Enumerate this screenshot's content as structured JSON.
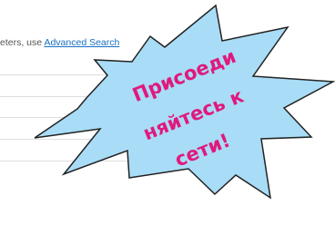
{
  "search": {
    "hint_prefix": "eters, use ",
    "advanced_link": "Advanced Search",
    "rows": 4
  },
  "promo": {
    "lines": [
      "Присоеди",
      "няйтесь к",
      "сети!"
    ],
    "fill_color": "#a9dcf6",
    "outline_color": "#222222",
    "text_color": "#e0197d"
  }
}
